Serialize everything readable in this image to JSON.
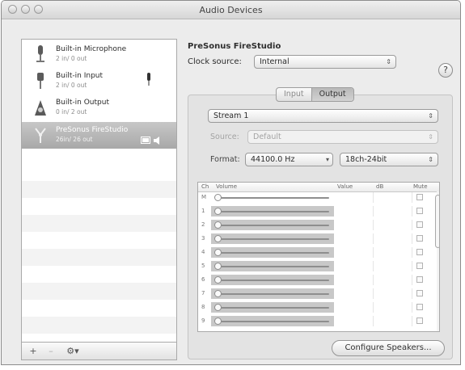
{
  "window": {
    "title": "Audio Devices"
  },
  "devices": [
    {
      "name": "Built-in Microphone",
      "sub": "2 in/ 0 out",
      "icon": "microphone-icon",
      "selected": false
    },
    {
      "name": "Built-in Input",
      "sub": "2 in/ 0 out",
      "icon": "line-input-icon",
      "selected": false
    },
    {
      "name": "Built-in Output",
      "sub": "0 in/ 2 out",
      "icon": "speaker-icon",
      "selected": false
    },
    {
      "name": "PreSonus FireStudio",
      "sub": "26in/ 26 out",
      "icon": "firewire-icon",
      "selected": true
    }
  ],
  "list_toolbar": {
    "add": "+",
    "remove": "–",
    "gear": "⚙▾"
  },
  "detail": {
    "device_name": "PreSonus FireStudio",
    "clock_label": "Clock source:",
    "clock_value": "Internal",
    "help": "?",
    "tabs": [
      {
        "label": "Input",
        "active": false
      },
      {
        "label": "Output",
        "active": true
      }
    ],
    "stream": "Stream 1",
    "source_label": "Source:",
    "source_value": "Default",
    "format_label": "Format:",
    "format_rate": "44100.0 Hz",
    "format_bits": "18ch-24bit"
  },
  "channel_table": {
    "headers": {
      "ch": "Ch",
      "volume": "Volume",
      "value": "Value",
      "db": "dB",
      "mute": "Mute"
    },
    "rows": [
      {
        "ch": "M",
        "master": true
      },
      {
        "ch": "1",
        "master": false
      },
      {
        "ch": "2",
        "master": false
      },
      {
        "ch": "3",
        "master": false
      },
      {
        "ch": "4",
        "master": false
      },
      {
        "ch": "5",
        "master": false
      },
      {
        "ch": "6",
        "master": false
      },
      {
        "ch": "7",
        "master": false
      },
      {
        "ch": "8",
        "master": false
      },
      {
        "ch": "9",
        "master": false
      }
    ]
  },
  "configure_speakers": "Configure Speakers..."
}
